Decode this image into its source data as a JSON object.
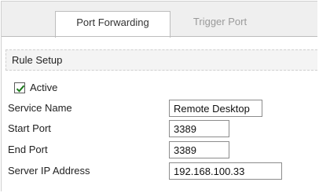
{
  "tabs": [
    {
      "label": "Port Forwarding",
      "active": true
    },
    {
      "label": "Trigger Port",
      "active": false
    }
  ],
  "rule_setup": {
    "title": "Rule Setup",
    "active": {
      "label": "Active",
      "checked": true
    },
    "fields": {
      "service_name": {
        "label": "Service Name",
        "value": "Remote Desktop"
      },
      "start_port": {
        "label": "Start Port",
        "value": "3389"
      },
      "end_port": {
        "label": "End Port",
        "value": "3389"
      },
      "server_ip": {
        "label": "Server IP Address",
        "value": "192.168.100.33"
      }
    }
  },
  "colors": {
    "tab_bar_bg": "#efefef",
    "inactive_tab_text": "#9a9a9a",
    "checkmark": "#1a7a1a"
  }
}
